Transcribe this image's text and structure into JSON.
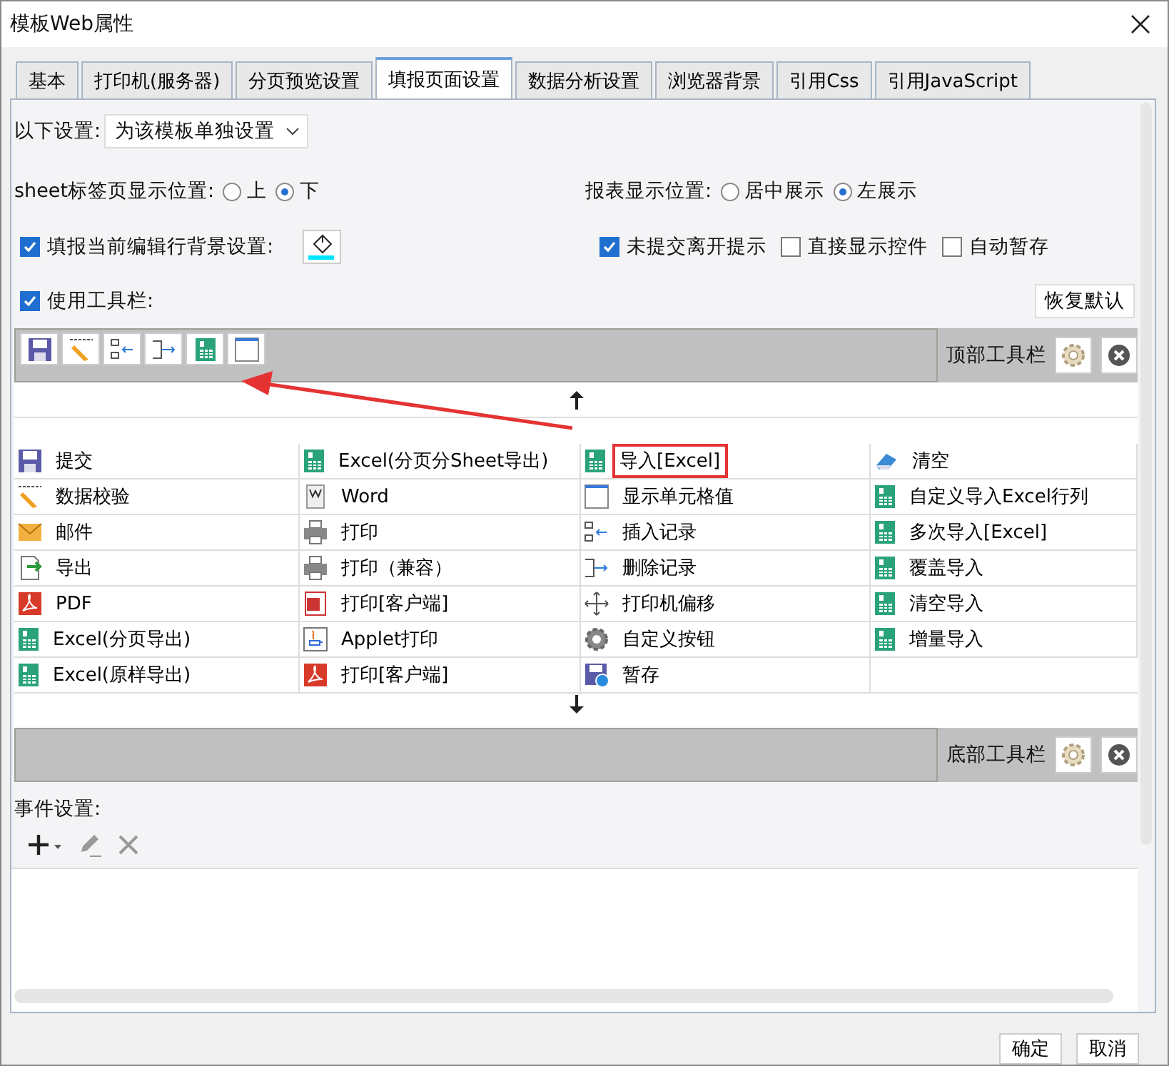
{
  "window": {
    "title": "模板Web属性"
  },
  "tabs": [
    {
      "label": "基本",
      "selected": false
    },
    {
      "label": "打印机(服务器)",
      "selected": false
    },
    {
      "label": "分页预览设置",
      "selected": false
    },
    {
      "label": "填报页面设置",
      "selected": true
    },
    {
      "label": "数据分析设置",
      "selected": false
    },
    {
      "label": "浏览器背景",
      "selected": false
    },
    {
      "label": "引用Css",
      "selected": false
    },
    {
      "label": "引用JavaScript",
      "selected": false
    }
  ],
  "settings_mode": {
    "label": "以下设置:",
    "value": "为该模板单独设置"
  },
  "sheet_position": {
    "label": "sheet标签页显示位置:",
    "options": [
      {
        "label": "上",
        "selected": false
      },
      {
        "label": "下",
        "selected": true
      }
    ]
  },
  "report_position": {
    "label": "报表显示位置:",
    "options": [
      {
        "label": "居中展示",
        "selected": false
      },
      {
        "label": "左展示",
        "selected": true
      }
    ]
  },
  "row_background": {
    "label": "填报当前编辑行背景设置:",
    "checked": true,
    "color": "#00e5ff"
  },
  "options_right": [
    {
      "label": "未提交离开提示",
      "checked": true
    },
    {
      "label": "直接显示控件",
      "checked": false
    },
    {
      "label": "自动暂存",
      "checked": false
    }
  ],
  "use_toolbar": {
    "label": "使用工具栏:",
    "checked": true
  },
  "restore_button": "恢复默认",
  "top_toolbar": {
    "label": "顶部工具栏"
  },
  "button_grid": [
    {
      "cells": [
        {
          "label": "提交",
          "highlighted": false
        },
        {
          "label": "Excel(分页分Sheet导出)",
          "highlighted": false
        },
        {
          "label": "导入[Excel]",
          "highlighted": true
        },
        {
          "label": "清空",
          "highlighted": false
        }
      ]
    },
    {
      "cells": [
        {
          "label": "数据校验",
          "highlighted": false
        },
        {
          "label": "Word",
          "highlighted": false
        },
        {
          "label": "显示单元格值",
          "highlighted": false
        },
        {
          "label": "自定义导入Excel行列",
          "highlighted": false
        }
      ]
    },
    {
      "cells": [
        {
          "label": "邮件",
          "highlighted": false
        },
        {
          "label": "打印",
          "highlighted": false
        },
        {
          "label": "插入记录",
          "highlighted": false
        },
        {
          "label": "多次导入[Excel]",
          "highlighted": false
        }
      ]
    },
    {
      "cells": [
        {
          "label": "导出",
          "highlighted": false
        },
        {
          "label": "打印（兼容）",
          "highlighted": false
        },
        {
          "label": "删除记录",
          "highlighted": false
        },
        {
          "label": "覆盖导入",
          "highlighted": false
        }
      ]
    },
    {
      "cells": [
        {
          "label": "PDF",
          "highlighted": false
        },
        {
          "label": "打印[客户端]",
          "highlighted": false
        },
        {
          "label": "打印机偏移",
          "highlighted": false
        },
        {
          "label": "清空导入",
          "highlighted": false
        }
      ]
    },
    {
      "cells": [
        {
          "label": "Excel(分页导出)",
          "highlighted": false
        },
        {
          "label": "Applet打印",
          "highlighted": false
        },
        {
          "label": "自定义按钮",
          "highlighted": false
        },
        {
          "label": "增量导入",
          "highlighted": false
        }
      ]
    },
    {
      "cells": [
        {
          "label": "Excel(原样导出)",
          "highlighted": false
        },
        {
          "label": "打印[客户端]",
          "highlighted": false
        },
        {
          "label": "暂存",
          "highlighted": false
        }
      ]
    }
  ],
  "bottom_toolbar": {
    "label": "底部工具栏"
  },
  "events": {
    "label": "事件设置:"
  },
  "footer_buttons": [
    "确定",
    "取消"
  ]
}
